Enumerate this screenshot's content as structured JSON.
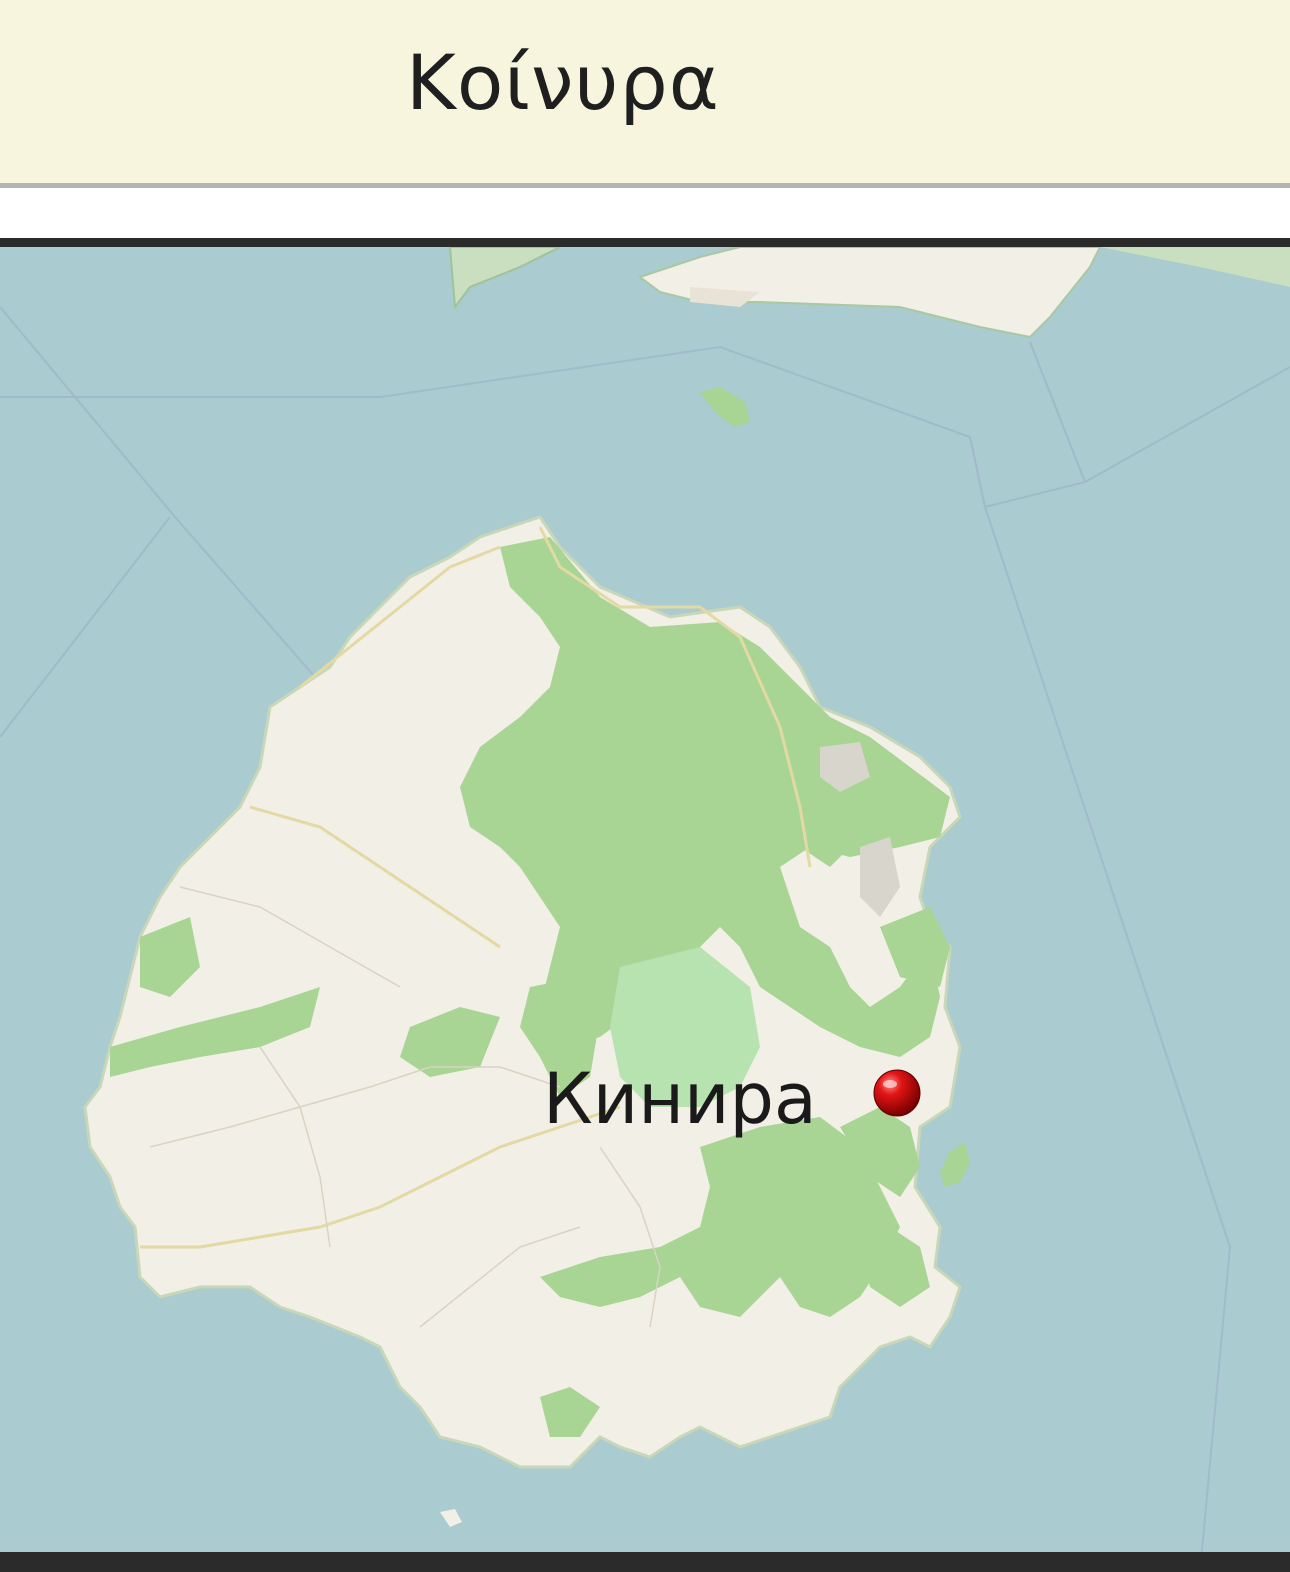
{
  "header": {
    "title": "Κοίνυρα"
  },
  "map": {
    "marker": {
      "label": "Кинира",
      "icon": "red-pin-icon",
      "color": "#d90f0f"
    },
    "colors": {
      "sea": "#aacbcf",
      "land": "#f2efe6",
      "forest": "#a8d494",
      "park": "#b7e3b0"
    }
  }
}
